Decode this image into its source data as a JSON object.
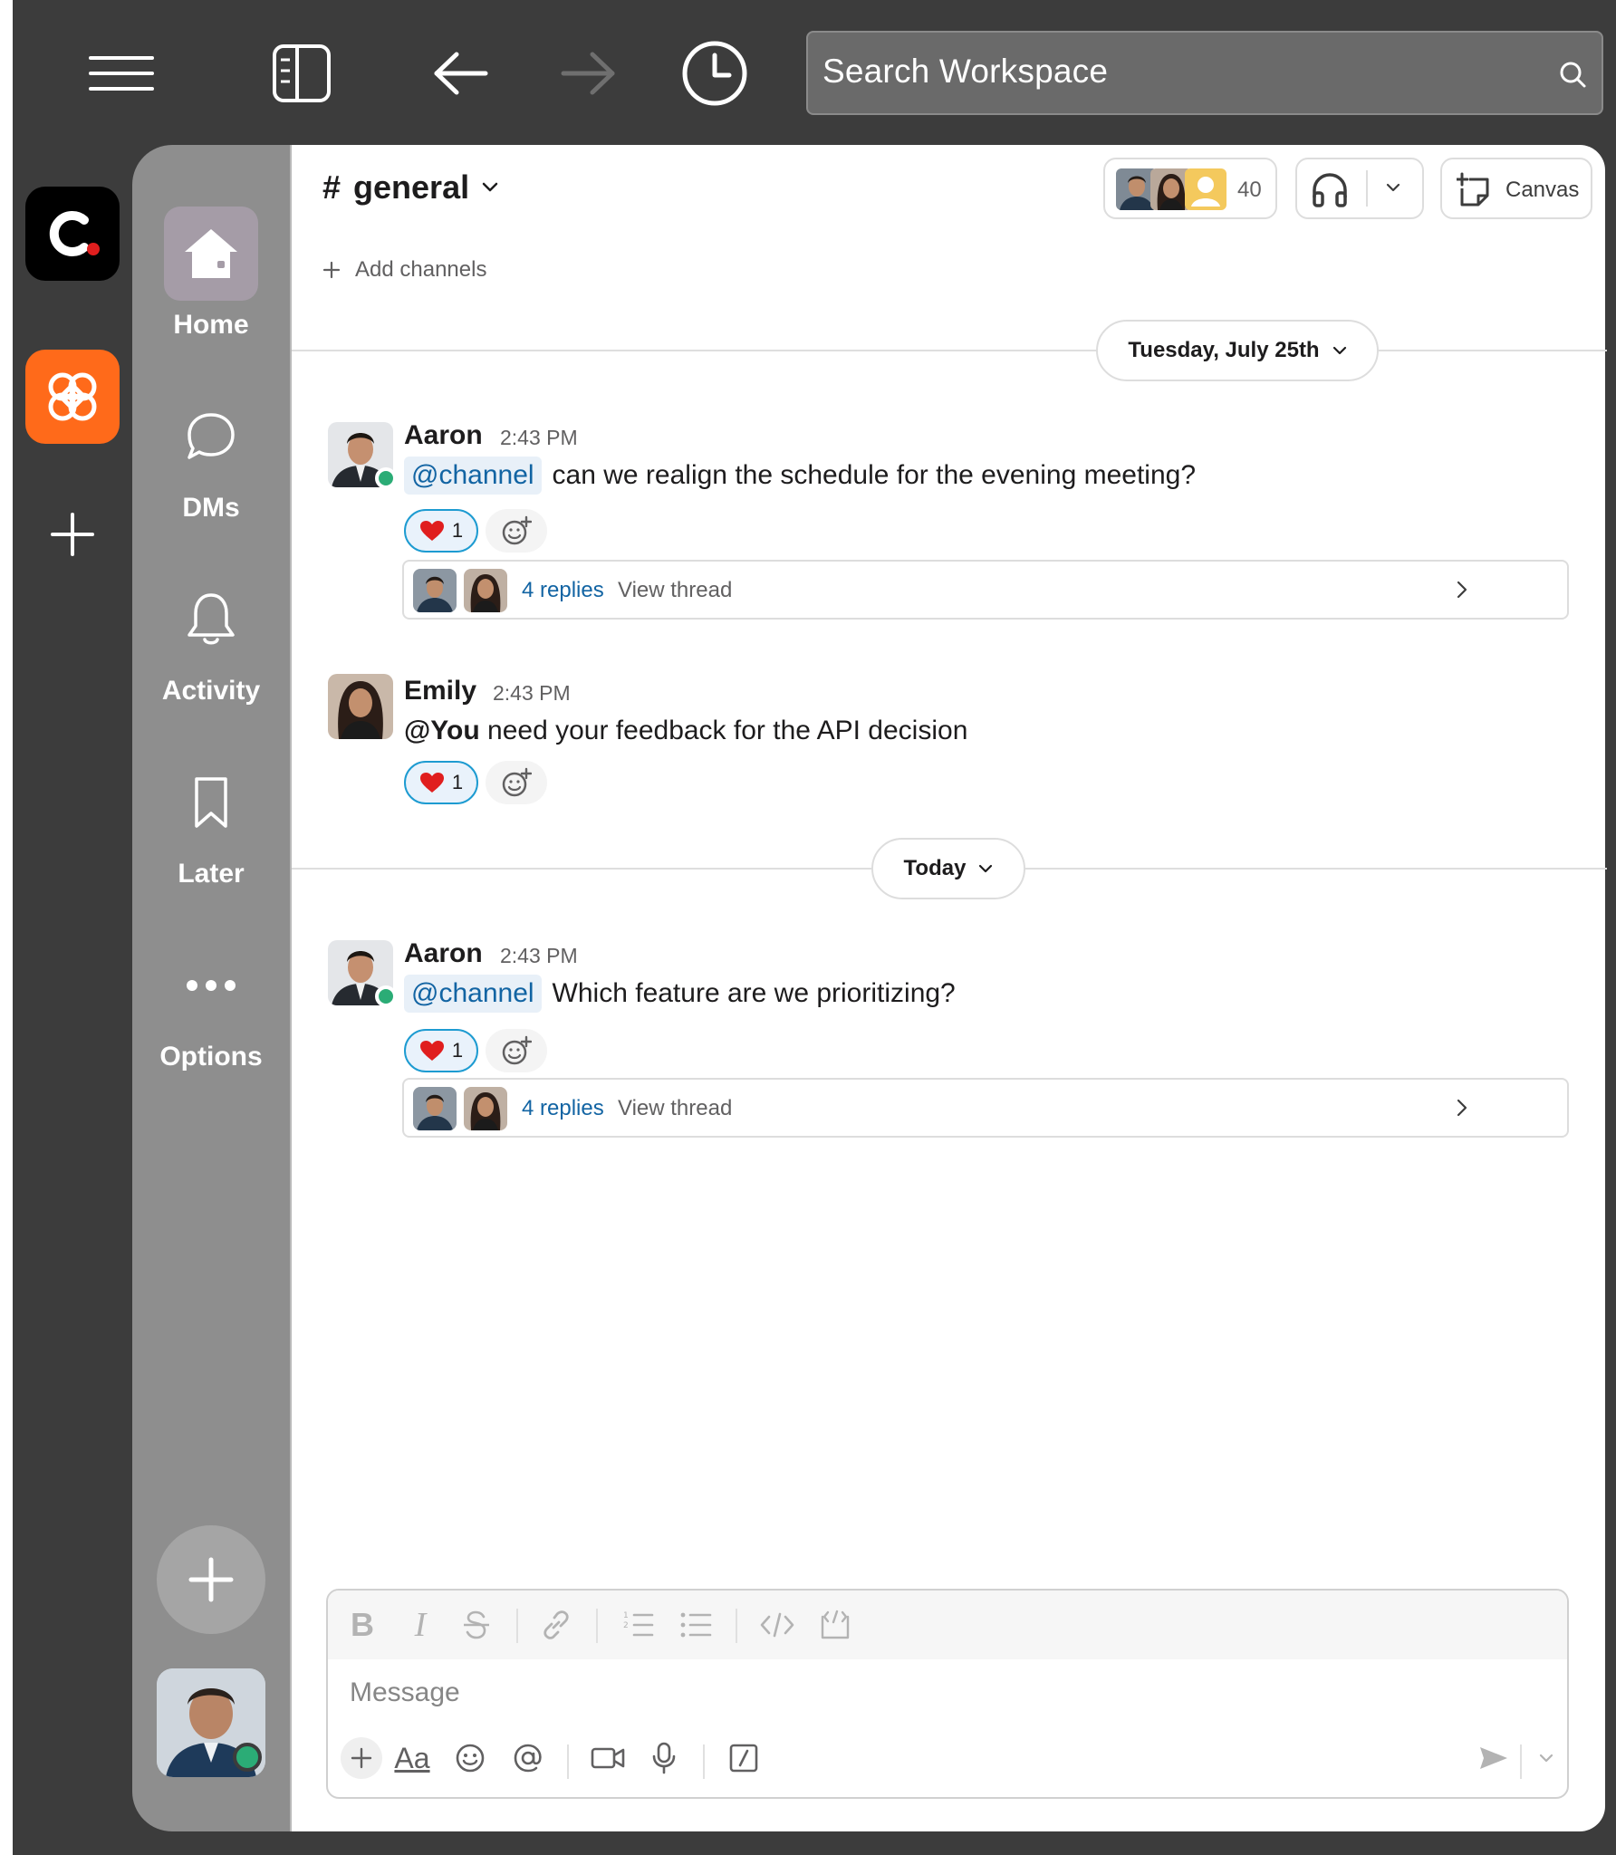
{
  "topbar": {
    "search_placeholder": "Search Workspace"
  },
  "workspaces": [
    {
      "name": "C.",
      "bg": "#000000",
      "dot": "#e01e1e"
    },
    {
      "name": "flower-workspace",
      "bg": "#ff6a1a"
    }
  ],
  "nav": {
    "home": "Home",
    "dms": "DMs",
    "activity": "Activity",
    "later": "Later",
    "options": "Options"
  },
  "channel": {
    "hash": "#",
    "name": "general",
    "member_count": "40",
    "canvas_label": "Canvas",
    "add_channels": "Add channels"
  },
  "dividers": {
    "first": "Tuesday, July 25th",
    "second": "Today"
  },
  "messages": [
    {
      "author": "Aaron",
      "time": "2:43 PM",
      "mention": "@channel",
      "text": "can we realign the schedule for the evening meeting?",
      "reaction_count": "1",
      "replies": "4 replies",
      "view_thread": "View thread"
    },
    {
      "author": "Emily",
      "time": "2:43 PM",
      "mention": "@You",
      "text": "need your feedback for the API decision",
      "reaction_count": "1"
    },
    {
      "author": "Aaron",
      "time": "2:43 PM",
      "mention": "@channel",
      "text": "Which feature are we prioritizing?",
      "reaction_count": "1",
      "replies": "4 replies",
      "view_thread": "View thread"
    }
  ],
  "composer": {
    "placeholder": "Message",
    "format_bold": "B",
    "format_italic": "I",
    "text_format": "Aa"
  },
  "colors": {
    "accent_link": "#1264a3",
    "presence": "#2bac76",
    "reaction_border": "#1d9bd1",
    "heart": "#e01e1e",
    "frame": "#3c3c3c",
    "nav_bg": "#8e8e8e"
  }
}
